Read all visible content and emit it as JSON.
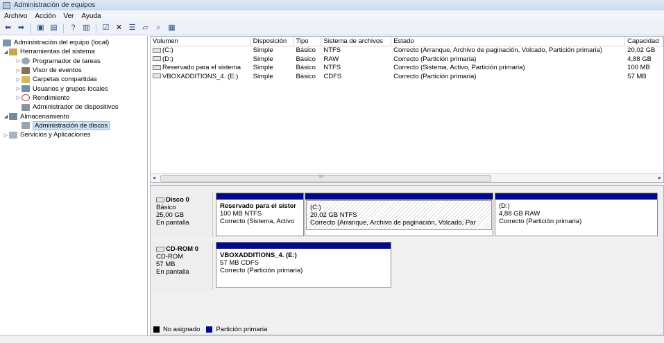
{
  "window": {
    "title": "Administración de equipos"
  },
  "menu": {
    "items": [
      "Archivo",
      "Acción",
      "Ver",
      "Ayuda"
    ]
  },
  "toolbar": {
    "icons": [
      "back-icon",
      "forward-icon",
      "up-icon",
      "show-hide-tree-icon",
      "help-icon",
      "console-icon",
      "check-icon",
      "delete-icon",
      "properties-icon",
      "open-icon",
      "search-icon",
      "disk-icon"
    ]
  },
  "tree": {
    "root": "Administración del equipo (local)",
    "items": [
      {
        "label": "Herramientas del sistema",
        "level": 1,
        "expand": "open"
      },
      {
        "label": "Programador de tareas",
        "level": 2,
        "expand": "closed"
      },
      {
        "label": "Visor de eventos",
        "level": 2,
        "expand": "closed"
      },
      {
        "label": "Carpetas compartidas",
        "level": 2,
        "expand": "closed"
      },
      {
        "label": "Usuarios y grupos locales",
        "level": 2,
        "expand": "closed"
      },
      {
        "label": "Rendimiento",
        "level": 2,
        "expand": "closed"
      },
      {
        "label": "Administrador de dispositivos",
        "level": 2,
        "expand": "none"
      },
      {
        "label": "Almacenamiento",
        "level": 1,
        "expand": "open"
      },
      {
        "label": "Administración de discos",
        "level": 2,
        "expand": "none",
        "selected": true
      },
      {
        "label": "Servicios y Aplicaciones",
        "level": 1,
        "expand": "closed"
      }
    ]
  },
  "volumes": {
    "headers": [
      "Volumen",
      "Disposición",
      "Tipo",
      "Sistema de archivos",
      "Estado",
      "Capacidad"
    ],
    "rows": [
      [
        "(C:)",
        "Simple",
        "Básico",
        "NTFS",
        "Correcto (Arranque, Archivo de paginación, Volcado, Partición primaria)",
        "20,02 GB"
      ],
      [
        "(D:)",
        "Simple",
        "Básico",
        "RAW",
        "Correcto (Partición primaria)",
        "4,88 GB"
      ],
      [
        "Reservado para el sistema",
        "Simple",
        "Básico",
        "NTFS",
        "Correcto (Sistema, Activo, Partición primaria)",
        "100 MB"
      ],
      [
        "VBOXADDITIONS_4. (E:)",
        "Simple",
        "Básico",
        "CDFS",
        "Correcto (Partición primaria)",
        "57 MB"
      ]
    ]
  },
  "scrollbar": {
    "grip": "III"
  },
  "disks": [
    {
      "name": "Disco 0",
      "type": "Básico",
      "size": "25,00 GB",
      "state": "En pantalla",
      "partitions": [
        {
          "name": "Reservado para el sister",
          "size": "100 MB NTFS",
          "status": "Correcto (Sistema, Activo"
        },
        {
          "name": "(C:)",
          "size": "20,02 GB NTFS",
          "status": "Correcto (Arranque, Archivo de paginación, Volcado, Par"
        },
        {
          "name": "(D:)",
          "size": "4,88 GB RAW",
          "status": "Correcto (Partición primaria)"
        }
      ]
    },
    {
      "name": "CD-ROM 0",
      "type": "CD-ROM",
      "size": "57 MB",
      "state": "En pantalla",
      "partitions": [
        {
          "name": "VBOXADDITIONS_4. (E:)",
          "size": "57 MB CDFS",
          "status": "Correcto (Partición primaria)"
        }
      ]
    }
  ],
  "legend": [
    {
      "label": "No asignado",
      "color": "#000000"
    },
    {
      "label": "Partición primaria",
      "color": "#000a88"
    }
  ]
}
